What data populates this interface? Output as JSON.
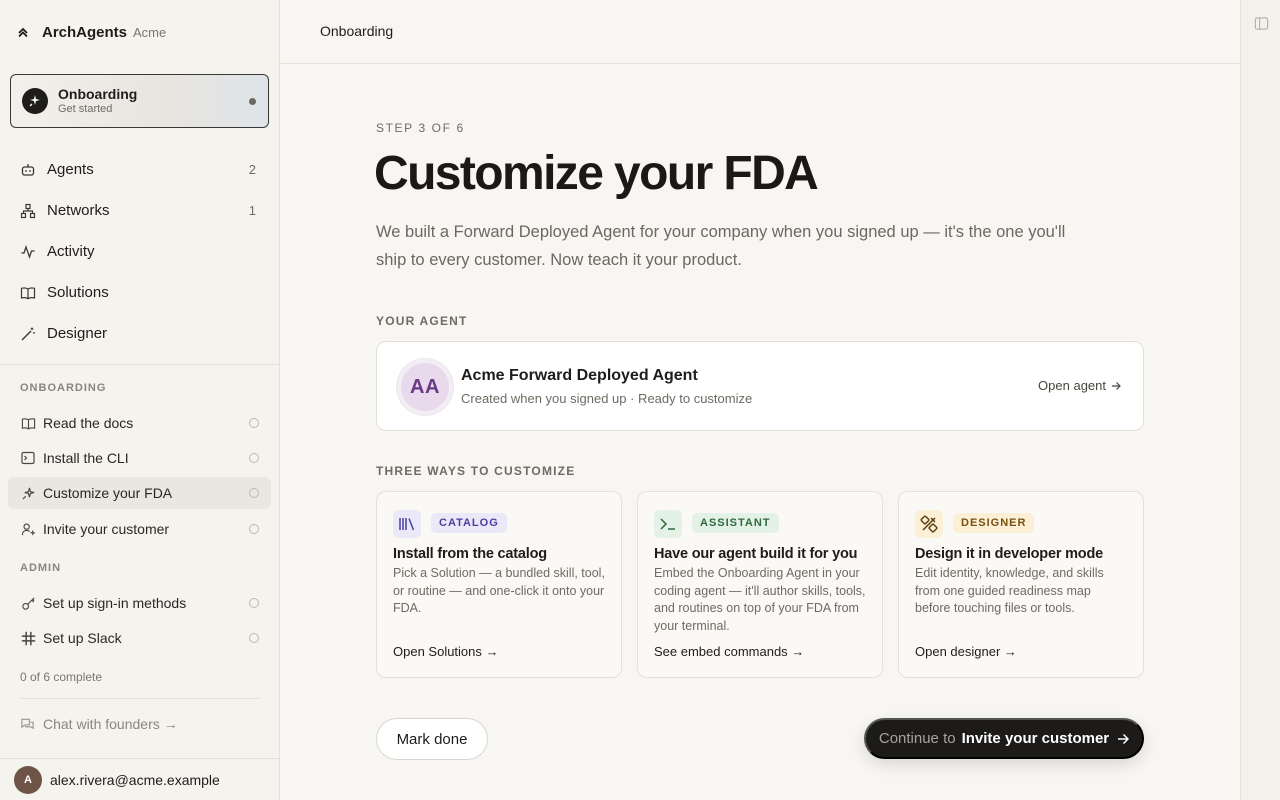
{
  "brand": {
    "name": "ArchAgents",
    "org": "Acme"
  },
  "onboarding_card": {
    "title": "Onboarding",
    "subtitle": "Get started"
  },
  "nav": [
    {
      "label": "Agents",
      "count": "2",
      "icon": "robot-icon"
    },
    {
      "label": "Networks",
      "count": "1",
      "icon": "network-icon"
    },
    {
      "label": "Activity",
      "count": "",
      "icon": "activity-icon"
    },
    {
      "label": "Solutions",
      "count": "",
      "icon": "book-icon"
    },
    {
      "label": "Designer",
      "count": "",
      "icon": "wand-icon"
    }
  ],
  "onboarding_section": {
    "label": "ONBOARDING",
    "items": [
      {
        "label": "Read the docs",
        "icon": "book-icon"
      },
      {
        "label": "Install the CLI",
        "icon": "terminal-icon"
      },
      {
        "label": "Customize your FDA",
        "icon": "sparkle-icon",
        "active": true
      },
      {
        "label": "Invite your customer",
        "icon": "user-plus-icon"
      }
    ]
  },
  "admin_section": {
    "label": "ADMIN",
    "items": [
      {
        "label": "Set up sign-in methods",
        "icon": "key-icon"
      },
      {
        "label": "Set up Slack",
        "icon": "slack-icon"
      }
    ]
  },
  "progress_text": "0 of 6 complete",
  "chat_link": "Chat with founders →",
  "user": {
    "initial": "A",
    "email": "alex.rivera@acme.example"
  },
  "topbar": {
    "crumb": "Onboarding"
  },
  "main": {
    "step_label": "STEP 3 OF 6",
    "title": "Customize your FDA",
    "description": "We built a Forward Deployed Agent for your company when you signed up — it's the one you'll ship to every customer. Now teach it your product.",
    "your_agent_label": "YOUR AGENT",
    "agent": {
      "initials": "AA",
      "name": "Acme Forward Deployed Agent",
      "subtitle": "Created when you signed up · Ready to customize",
      "open_label": "Open agent"
    },
    "ways_label": "THREE WAYS TO CUSTOMIZE",
    "ways": [
      {
        "tag": "CATALOG",
        "title": "Install from the catalog",
        "desc": "Pick a Solution — a bundled skill, tool, or routine — and one-click it onto your FDA.",
        "link": "Open Solutions →",
        "icon": "library-icon",
        "tag_bg": "#ebe8f7",
        "tag_fg": "#4a3fa3",
        "icon_bg": "#ebe8f7"
      },
      {
        "tag": "ASSISTANT",
        "title": "Have our agent build it for you",
        "desc": "Embed the Onboarding Agent in your coding agent — it'll author skills, tools, and routines on top of your FDA from your terminal.",
        "link": "See embed commands →",
        "icon": "terminal-icon",
        "tag_bg": "#e3f1e6",
        "tag_fg": "#2d6b3e",
        "icon_bg": "#e3f1e6"
      },
      {
        "tag": "DESIGNER",
        "title": "Design it in developer mode",
        "desc": "Edit identity, knowledge, and skills from one guided readiness map before touching files or tools.",
        "link": "Open designer →",
        "icon": "design-tools-icon",
        "tag_bg": "#fbefd6",
        "tag_fg": "#7a4f0e",
        "icon_bg": "#fbefd6"
      }
    ],
    "mark_done": "Mark done",
    "continue_prefix": "Continue to",
    "continue_target": "Invite your customer"
  }
}
